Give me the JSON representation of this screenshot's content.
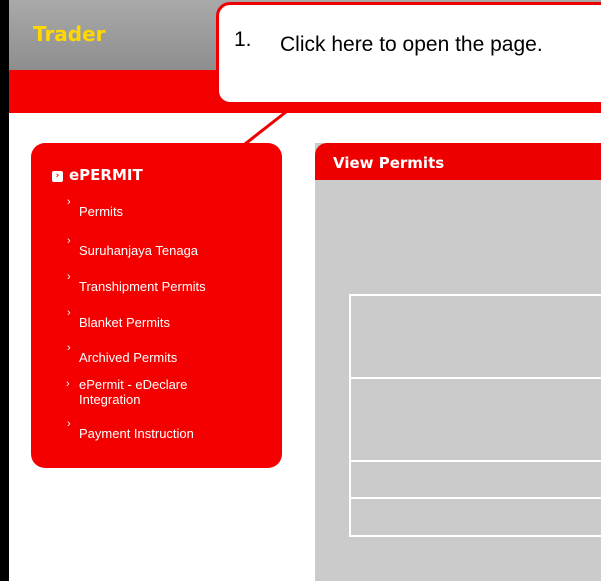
{
  "header": {
    "title": "Trader"
  },
  "callout": {
    "number": "1.",
    "text": "Click here to open the page."
  },
  "nav": {
    "title": "ePERMIT",
    "items": [
      {
        "label": "Permits"
      },
      {
        "label": "Suruhanjaya Tenaga"
      },
      {
        "label": "Transhipment Permits"
      },
      {
        "label": "Blanket Permits"
      },
      {
        "label": "Archived Permits"
      },
      {
        "label": "ePermit - eDeclare Integration"
      },
      {
        "label": "Payment Instruction"
      }
    ]
  },
  "view": {
    "title": "View Permits"
  },
  "colors": {
    "accent_red": "#f50000",
    "header_gray": "#9a9a9a",
    "title_yellow": "#ffd800",
    "panel_gray": "#cbcbcb"
  }
}
